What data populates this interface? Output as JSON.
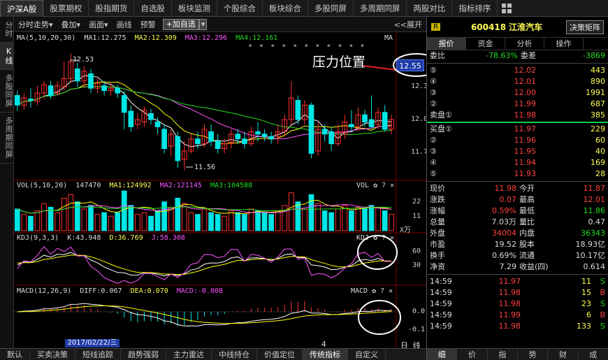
{
  "topnav": {
    "tabs": [
      "沪深A股",
      "股票期权",
      "股指期货",
      "自选股",
      "板块监测",
      "个股综合",
      "板块综合",
      "多股同屏",
      "多周期同屏",
      "两股对比",
      "指标排序"
    ],
    "active": 0
  },
  "leftbar": [
    "分时",
    "K线",
    "多股同屏",
    "多周期同屏"
  ],
  "toolbar": {
    "items": [
      "分时走势▾",
      "叠加▾",
      "画面▾",
      "画线",
      "预警"
    ],
    "add_label": "+加自选",
    "expand_label": "<<展开"
  },
  "main_panel": {
    "title": "MA(5,10,20,30)",
    "ma1": "MA1:12.275",
    "ma2": "MA2:12.309",
    "ma3": "MA3:12.296",
    "ma4": "MA4:12.161",
    "corner": "MA",
    "stars": "* *   * * * * * * *   * *",
    "high_label": "12.53",
    "low_label": "11.56",
    "annotation": "压力位置",
    "price_box": "12.55",
    "y_ticks": [
      "12.3",
      "12.0",
      "11.7"
    ]
  },
  "vol_panel": {
    "title": "VOL(5,10,20)",
    "v": "147470",
    "ma1": "MA1:124992",
    "ma2": "MA2:121145",
    "ma3": "MA3:104588",
    "corner": "VOL",
    "y_ticks": [
      "22",
      "11"
    ],
    "unit": "X万"
  },
  "kdj_panel": {
    "title": "KDJ(9,3,3)",
    "k": "K:43.948",
    "d": "D:36.769",
    "j": "J:58.308",
    "corner": "KDJ",
    "y_ticks": [
      "60",
      "30",
      "0"
    ]
  },
  "macd_panel": {
    "title": "MACD(12,26,9)",
    "diff": "DIFF:0.067",
    "dea": "DEA:0.070",
    "macd": "MACD:-0.008",
    "corner": "MACD",
    "y_ticks": [
      "0.0",
      "-0.1"
    ]
  },
  "date_label": "2017/02/22/三",
  "page_num": "4",
  "period_label": "日 线",
  "bottom_tabs": [
    "默认",
    "买卖决策",
    "短线追踪",
    "趋势强弱",
    "主力雷达",
    "中线持仓",
    "价值定位",
    "传统指标",
    "自定义"
  ],
  "bottom_active": 7,
  "right": {
    "badge": "R",
    "code": "600418",
    "name": "江淮汽车",
    "decision_btn": "决策矩阵",
    "tabs": [
      "报价",
      "资金",
      "分析",
      "操作"
    ],
    "weibi_label": "委比",
    "weibi": "-78.63%",
    "weicha_label": "委差",
    "weicha": "-3869",
    "asks": [
      {
        "lvl": "⑤",
        "price": "12.02",
        "vol": "443"
      },
      {
        "lvl": "④",
        "price": "12.01",
        "vol": "890"
      },
      {
        "lvl": "③",
        "price": "12.00",
        "vol": "1991"
      },
      {
        "lvl": "②",
        "price": "11.99",
        "vol": "687"
      },
      {
        "lvl": "卖盘①",
        "price": "11.98",
        "vol": "385"
      }
    ],
    "bids": [
      {
        "lvl": "买盘①",
        "price": "11.97",
        "vol": "229"
      },
      {
        "lvl": "②",
        "price": "11.96",
        "vol": "60"
      },
      {
        "lvl": "③",
        "price": "11.95",
        "vol": "40"
      },
      {
        "lvl": "④",
        "price": "11.94",
        "vol": "169"
      },
      {
        "lvl": "⑤",
        "price": "11.93",
        "vol": "28"
      }
    ],
    "stats": [
      [
        "现价",
        "11.98",
        "今开",
        "11.87"
      ],
      [
        "涨跌",
        "0.07",
        "最高",
        "12.01"
      ],
      [
        "涨幅",
        "0.59%",
        "最低",
        "11.86"
      ],
      [
        "总量",
        "7.03万",
        "量比",
        "0.47"
      ],
      [
        "外盘",
        "34004",
        "内盘",
        "36343"
      ],
      [
        "市盈",
        "19.52",
        "股本",
        "18.93亿"
      ],
      [
        "换手",
        "0.69%",
        "流通",
        "10.17亿"
      ],
      [
        "净资",
        "7.29",
        "收益(四)",
        "0.614"
      ]
    ],
    "ticks": [
      {
        "t": "14:59",
        "p": "11.97",
        "v": "11",
        "s": "S"
      },
      {
        "t": "14:59",
        "p": "11.98",
        "v": "15",
        "s": "B"
      },
      {
        "t": "14:59",
        "p": "11.98",
        "v": "23",
        "s": "S"
      },
      {
        "t": "14:59",
        "p": "11.99",
        "v": "6",
        "s": "B"
      },
      {
        "t": "14:59",
        "p": "11.98",
        "v": "133",
        "s": "S"
      }
    ],
    "bottom_tabs": [
      "细",
      "价",
      "指",
      "势",
      "财",
      "成"
    ]
  },
  "chart_data": {
    "type": "candlestick",
    "candles": [
      [
        12.18,
        12.1,
        12.22,
        12.05
      ],
      [
        12.1,
        12.16,
        12.2,
        12.06
      ],
      [
        12.15,
        12.14,
        12.24,
        12.08
      ],
      [
        12.13,
        12.2,
        12.26,
        12.1
      ],
      [
        12.2,
        12.27,
        12.3,
        12.15
      ],
      [
        12.26,
        12.18,
        12.3,
        12.15
      ],
      [
        12.2,
        12.26,
        12.3,
        12.18
      ],
      [
        12.25,
        12.32,
        12.46,
        12.22
      ],
      [
        12.32,
        12.46,
        12.53,
        12.28
      ],
      [
        12.4,
        12.3,
        12.45,
        12.25
      ],
      [
        12.3,
        12.38,
        12.42,
        12.24
      ],
      [
        12.36,
        12.24,
        12.4,
        12.2
      ],
      [
        12.24,
        12.28,
        12.32,
        12.2
      ],
      [
        12.26,
        12.22,
        12.3,
        12.18
      ],
      [
        12.22,
        12.24,
        12.28,
        12.18
      ],
      [
        12.24,
        12.2,
        12.27,
        12.16
      ],
      [
        12.18,
        12.04,
        12.22,
        11.9
      ],
      [
        12.05,
        11.92,
        12.1,
        11.88
      ],
      [
        11.94,
        11.98,
        12.03,
        11.9
      ],
      [
        11.96,
        12.06,
        12.09,
        11.92
      ],
      [
        12.03,
        11.98,
        12.07,
        11.94
      ],
      [
        11.96,
        11.92,
        12.0,
        11.86
      ],
      [
        11.9,
        11.74,
        11.94,
        11.7
      ],
      [
        11.76,
        11.86,
        11.9,
        11.68
      ],
      [
        11.84,
        11.64,
        11.88,
        11.58
      ],
      [
        11.65,
        11.72,
        11.8,
        11.56
      ],
      [
        11.72,
        11.82,
        11.86,
        11.7
      ],
      [
        11.82,
        11.78,
        11.88,
        11.74
      ],
      [
        11.78,
        11.9,
        11.94,
        11.75
      ],
      [
        11.88,
        11.8,
        11.94,
        11.76
      ],
      [
        11.8,
        11.74,
        11.86,
        11.7
      ],
      [
        11.74,
        11.78,
        11.82,
        11.7
      ],
      [
        11.78,
        11.86,
        11.9,
        11.74
      ],
      [
        11.86,
        11.82,
        11.9,
        11.78
      ],
      [
        11.82,
        11.78,
        11.88,
        11.74
      ],
      [
        11.78,
        11.88,
        11.92,
        11.76
      ],
      [
        11.88,
        11.86,
        11.96,
        11.8
      ],
      [
        11.86,
        11.84,
        11.9,
        11.8
      ],
      [
        11.84,
        11.82,
        11.88,
        11.78
      ],
      [
        11.84,
        11.88,
        11.94,
        11.78
      ],
      [
        11.88,
        11.98,
        12.02,
        11.84
      ],
      [
        11.98,
        12.16,
        12.3,
        11.94
      ],
      [
        12.14,
        11.98,
        12.18,
        11.94
      ],
      [
        11.98,
        12.1,
        12.14,
        11.94
      ],
      [
        12.1,
        11.7,
        12.12,
        11.66
      ],
      [
        11.72,
        11.9,
        11.96,
        11.68
      ],
      [
        11.9,
        11.86,
        11.94,
        11.8
      ],
      [
        11.88,
        11.78,
        11.92,
        11.72
      ],
      [
        11.78,
        11.88,
        11.94,
        11.76
      ],
      [
        11.86,
        11.96,
        12.02,
        11.82
      ],
      [
        11.94,
        11.92,
        12.06,
        11.88
      ],
      [
        11.92,
        12.02,
        12.08,
        11.88
      ],
      [
        12.02,
        11.96,
        12.06,
        11.92
      ],
      [
        11.98,
        11.92,
        12.18,
        11.9
      ],
      [
        11.94,
        12.04,
        12.08,
        11.9
      ],
      [
        12.04,
        11.9,
        12.1,
        11.88
      ],
      [
        11.9,
        11.98,
        12.02,
        11.86
      ]
    ],
    "volume": [
      12,
      9,
      8,
      11,
      15,
      13,
      10,
      18,
      20,
      16,
      12,
      14,
      9,
      10,
      8,
      10,
      22,
      14,
      9,
      10,
      8,
      11,
      16,
      13,
      18,
      15,
      10,
      9,
      12,
      10,
      9,
      8,
      11,
      10,
      9,
      12,
      11,
      10,
      9,
      11,
      14,
      21,
      16,
      12,
      20,
      15,
      11,
      10,
      12,
      14,
      11,
      13,
      12,
      14,
      13,
      11,
      9
    ],
    "y_range": [
      11.5,
      12.6
    ]
  }
}
